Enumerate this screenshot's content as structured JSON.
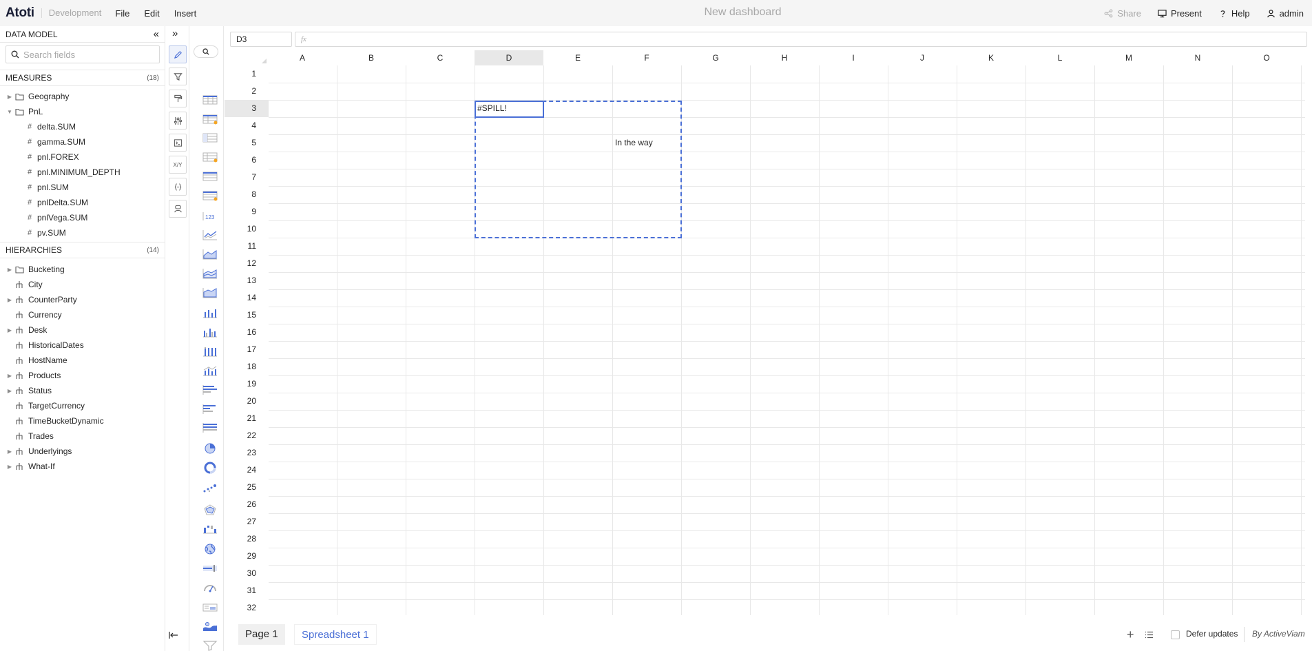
{
  "app": {
    "logo": "Atoti",
    "environment": "Development",
    "menu": [
      "File",
      "Edit",
      "Insert"
    ],
    "dashboard_title": "New dashboard",
    "actions": {
      "share": "Share",
      "present": "Present",
      "help": "Help",
      "user": "admin"
    }
  },
  "data_model": {
    "title": "DATA MODEL",
    "search_placeholder": "Search fields",
    "measures": {
      "label": "MEASURES",
      "count": "(18)",
      "folders": [
        {
          "name": "Geography",
          "expanded": false
        },
        {
          "name": "PnL",
          "expanded": true
        }
      ],
      "items": [
        "delta.SUM",
        "gamma.SUM",
        "pnl.FOREX",
        "pnl.MINIMUM_DEPTH",
        "pnl.SUM",
        "pnlDelta.SUM",
        "pnlVega.SUM",
        "pv.SUM"
      ]
    },
    "hierarchies": {
      "label": "HIERARCHIES",
      "count": "(14)",
      "items": [
        {
          "name": "Bucketing",
          "kind": "folder",
          "expandable": true
        },
        {
          "name": "City",
          "kind": "hierarchy",
          "expandable": false
        },
        {
          "name": "CounterParty",
          "kind": "hierarchy",
          "expandable": true
        },
        {
          "name": "Currency",
          "kind": "hierarchy",
          "expandable": false
        },
        {
          "name": "Desk",
          "kind": "hierarchy",
          "expandable": true
        },
        {
          "name": "HistoricalDates",
          "kind": "hierarchy",
          "expandable": false
        },
        {
          "name": "HostName",
          "kind": "hierarchy",
          "expandable": false
        },
        {
          "name": "Products",
          "kind": "hierarchy",
          "expandable": true
        },
        {
          "name": "Status",
          "kind": "hierarchy",
          "expandable": true
        },
        {
          "name": "TargetCurrency",
          "kind": "hierarchy",
          "expandable": false
        },
        {
          "name": "TimeBucketDynamic",
          "kind": "hierarchy",
          "expandable": false
        },
        {
          "name": "Trades",
          "kind": "hierarchy",
          "expandable": false
        },
        {
          "name": "Underlyings",
          "kind": "hierarchy",
          "expandable": true
        },
        {
          "name": "What-If",
          "kind": "hierarchy",
          "expandable": true
        }
      ]
    }
  },
  "toolstrip": {
    "tools": [
      "pencil-icon",
      "filter-icon",
      "paint-roller-icon",
      "sliders-icon",
      "terminal-icon",
      "xy-icon",
      "braces-icon",
      "widget-icon"
    ],
    "xy_label": "X/Y",
    "chart_icons": [
      "table",
      "table-highlight",
      "pivot-table",
      "pivot-highlight",
      "tree-table",
      "tree-table-highlight",
      "kpi",
      "line",
      "area",
      "stacked-area",
      "area-100",
      "column",
      "clustered-column",
      "stacked-column",
      "combo",
      "bar",
      "clustered-bar",
      "stacked-bar",
      "pie",
      "donut",
      "scatter",
      "radar",
      "waterfall",
      "map",
      "bullet",
      "gauge",
      "text",
      "bubble-map",
      "funnel"
    ],
    "kpi_label": "123"
  },
  "formula_bar": {
    "cell_ref": "D3",
    "fx_label": "fx",
    "formula": ""
  },
  "sheet": {
    "columns": [
      "A",
      "B",
      "C",
      "D",
      "E",
      "F",
      "G",
      "H",
      "I",
      "J",
      "K",
      "L",
      "M",
      "N",
      "O"
    ],
    "rows": [
      "1",
      "2",
      "3",
      "4",
      "5",
      "6",
      "7",
      "8",
      "9",
      "10",
      "11",
      "12",
      "13",
      "14",
      "15",
      "16",
      "17",
      "18",
      "19",
      "20",
      "21",
      "22",
      "23",
      "24",
      "25",
      "26",
      "27",
      "28",
      "29",
      "30",
      "31",
      "32"
    ],
    "selected_column": "D",
    "selected_row": "3",
    "cells": [
      {
        "ref": "D3",
        "text": "#SPILL!",
        "col": 3,
        "row": 2
      },
      {
        "ref": "F5",
        "text": "In the way",
        "col": 5,
        "row": 4
      }
    ],
    "spill_range": "D3:F10"
  },
  "bottom": {
    "tabs": [
      "Page 1",
      "Spreadsheet 1"
    ],
    "defer_label": "Defer updates",
    "brand": "By ActiveViam"
  }
}
